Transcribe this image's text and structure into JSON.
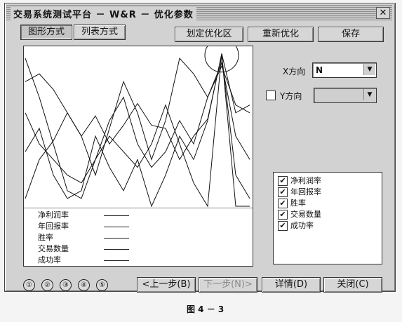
{
  "window": {
    "title": "交易系统测试平台 － W&R － 优化参数",
    "close_glyph": "✕"
  },
  "toolbar": {
    "graph_mode": "图形方式",
    "list_mode": "列表方式",
    "define_region": "划定优化区",
    "reoptimize": "重新优化",
    "save": "保存"
  },
  "x_axis": {
    "label": "X方向",
    "value": "N"
  },
  "y_axis": {
    "label": "Y方向",
    "value": "",
    "checked": false
  },
  "legend": {
    "items": [
      "净利润率",
      "年回报率",
      "胜率",
      "交易数量",
      "成功率"
    ]
  },
  "series_checklist": {
    "items": [
      {
        "label": "净利润率",
        "checked": true
      },
      {
        "label": "年回报率",
        "checked": true
      },
      {
        "label": "胜率",
        "checked": true
      },
      {
        "label": "交易数量",
        "checked": true
      },
      {
        "label": "成功率",
        "checked": true
      }
    ],
    "check_glyph": "✔"
  },
  "steps": [
    "①",
    "②",
    "③",
    "④",
    "⑤"
  ],
  "footer": {
    "prev": "<上一步(B)",
    "next": "下一步(N)>",
    "details": "详情(D)",
    "close": "关闭(C)"
  },
  "caption": "图 4 － 3",
  "plot": {
    "series": [
      [
        0.05,
        0.3,
        0.42,
        0.6,
        0.45,
        0.58,
        0.4,
        0.52,
        0.66,
        0.52,
        0.5,
        0.3,
        0.45,
        0.56,
        0.97,
        0.2,
        0.05
      ],
      [
        0.95,
        0.7,
        0.4,
        0.1,
        0.05,
        0.3,
        0.55,
        0.7,
        0.4,
        0.25,
        0.35,
        0.55,
        0.4,
        0.7,
        0.9,
        0.65,
        0.6
      ],
      [
        0.8,
        0.85,
        0.75,
        0.6,
        0.45,
        0.2,
        0.5,
        0.8,
        0.6,
        0.3,
        0.55,
        0.95,
        0.85,
        0.7,
        0.92,
        0.45,
        0.3
      ],
      [
        0.6,
        0.4,
        0.3,
        0.2,
        0.15,
        0.3,
        0.45,
        0.35,
        0.25,
        0.4,
        0.65,
        0.4,
        0.15,
        0.0,
        0.98,
        0.6,
        0.65
      ],
      [
        0.35,
        0.5,
        0.2,
        0.05,
        0.1,
        0.45,
        0.25,
        0.1,
        0.3,
        0.0,
        0.2,
        0.45,
        0.3,
        0.55,
        0.98,
        0.0,
        0.0
      ]
    ],
    "highlight": {
      "index": 14,
      "value": 0.97
    }
  }
}
